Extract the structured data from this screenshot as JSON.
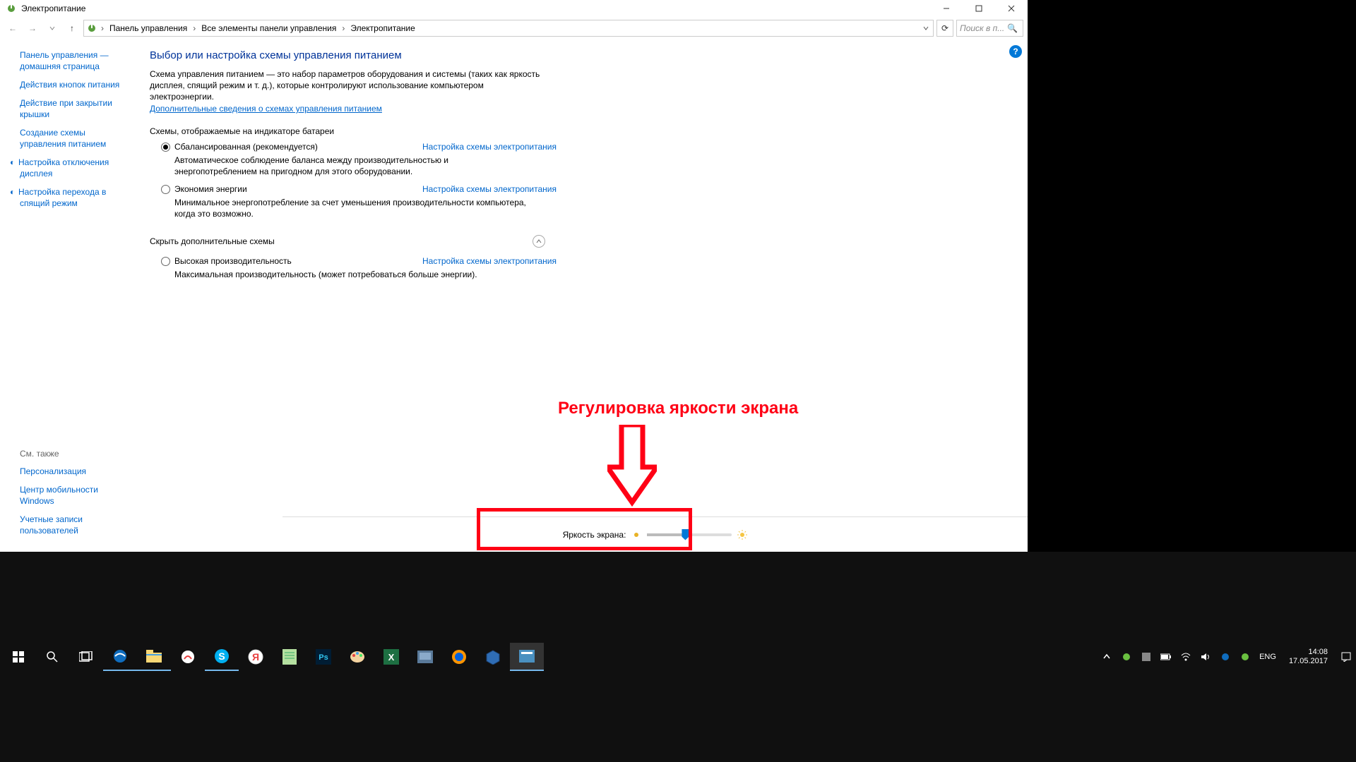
{
  "window": {
    "title": "Электропитание",
    "breadcrumbs": [
      "Панель управления",
      "Все элементы панели управления",
      "Электропитание"
    ],
    "search_placeholder": "Поиск в п..."
  },
  "sidebar": {
    "links": [
      "Панель управления — домашняя страница",
      "Действия кнопок питания",
      "Действие при закрытии крышки",
      "Создание схемы управления питанием",
      "Настройка отключения дисплея",
      "Настройка перехода в спящий режим"
    ],
    "see_also_title": "См. также",
    "see_also": [
      "Персонализация",
      "Центр мобильности Windows",
      "Учетные записи пользователей"
    ]
  },
  "main": {
    "heading": "Выбор или настройка схемы управления питанием",
    "intro": "Схема управления питанием — это набор параметров оборудования и системы (таких как яркость дисплея, спящий режим и т. д.), которые контролируют использование компьютером электроэнергии.",
    "learn_more": "Дополнительные сведения о схемах управления питанием",
    "section_battery": "Схемы, отображаемые на индикаторе батареи",
    "plans": [
      {
        "name": "Сбалансированная (рекомендуется)",
        "desc": "Автоматическое соблюдение баланса между производительностью и энергопотреблением на пригодном для этого оборудовании.",
        "link": "Настройка схемы электропитания",
        "checked": true
      },
      {
        "name": "Экономия энергии",
        "desc": "Минимальное энергопотребление за счет уменьшения производительности компьютера, когда это возможно.",
        "link": "Настройка схемы электропитания",
        "checked": false
      }
    ],
    "hide_label": "Скрыть дополнительные схемы",
    "extra_plans": [
      {
        "name": "Высокая производительность",
        "desc": "Максимальная производительность (может потребоваться больше энергии).",
        "link": "Настройка схемы электропитания",
        "checked": false
      }
    ],
    "brightness_label": "Яркость экрана:"
  },
  "annotation": {
    "text": "Регулировка яркости экрана"
  },
  "taskbar": {
    "lang": "ENG",
    "time": "14:08",
    "date": "17.05.2017"
  }
}
